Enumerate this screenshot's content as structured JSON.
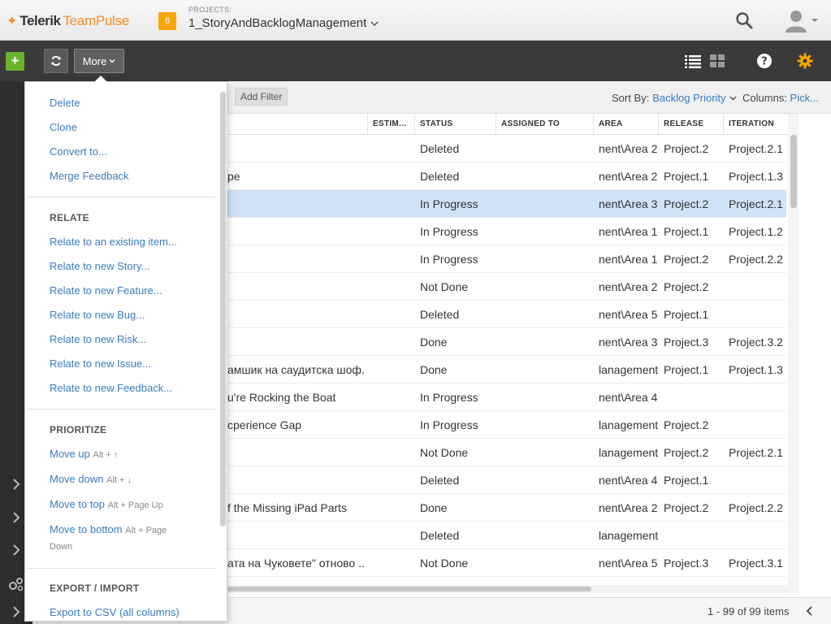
{
  "app": {
    "brand_primary": "Telerik",
    "brand_secondary": "TeamPulse",
    "accent_color": "#f68b1f"
  },
  "project": {
    "badge": "8",
    "caption": "PROJECTS:",
    "name": "1_StoryAndBacklogManagement"
  },
  "toolbar": {
    "more_label": "More",
    "add_icon": "plus-icon",
    "refresh_icon": "refresh-icon"
  },
  "filter": {
    "add_filter_label": "Add Filter",
    "sort_by_label": "Sort By:",
    "sort_by_value": "Backlog Priority",
    "columns_label": "Columns:",
    "columns_value": "Pick..."
  },
  "grid": {
    "headers": [
      "ESTIM...",
      "STATUS",
      "ASSIGNED TO",
      "AREA",
      "RELEASE",
      "ITERATION"
    ],
    "rows": [
      {
        "name": "",
        "status": "Deleted",
        "assigned": "",
        "area": "nent\\Area 2",
        "release": "Project.2",
        "iteration": "Project.2.1"
      },
      {
        "name": "pe",
        "status": "Deleted",
        "assigned": "",
        "area": "nent\\Area 2",
        "release": "Project.1",
        "iteration": "Project.1.3"
      },
      {
        "name": "",
        "status": "In Progress",
        "assigned": "",
        "area": "nent\\Area 3",
        "release": "Project.2",
        "iteration": "Project.2.1"
      },
      {
        "name": "",
        "status": "In Progress",
        "assigned": "",
        "area": "nent\\Area 1",
        "release": "Project.1",
        "iteration": "Project.1.2"
      },
      {
        "name": "",
        "status": "In Progress",
        "assigned": "",
        "area": "nent\\Area 1",
        "release": "Project.2",
        "iteration": "Project.2.2"
      },
      {
        "name": "",
        "status": "Not Done",
        "assigned": "",
        "area": "nent\\Area 2",
        "release": "Project.2",
        "iteration": ""
      },
      {
        "name": "",
        "status": "Deleted",
        "assigned": "",
        "area": "nent\\Area 5",
        "release": "Project.1",
        "iteration": ""
      },
      {
        "name": "",
        "status": "Done",
        "assigned": "",
        "area": "nent\\Area 3",
        "release": "Project.3",
        "iteration": "Project.3.2"
      },
      {
        "name": "амшик на саудитска шоф...",
        "status": "Done",
        "assigned": "",
        "area": "lanagement",
        "release": "Project.1",
        "iteration": "Project.1.3"
      },
      {
        "name": "u're Rocking the Boat",
        "status": "In Progress",
        "assigned": "",
        "area": "nent\\Area 4",
        "release": "",
        "iteration": ""
      },
      {
        "name": "cperience Gap",
        "status": "In Progress",
        "assigned": "",
        "area": "lanagement",
        "release": "Project.2",
        "iteration": ""
      },
      {
        "name": "",
        "status": "Not Done",
        "assigned": "",
        "area": "lanagement",
        "release": "Project.2",
        "iteration": "Project.2.1"
      },
      {
        "name": "",
        "status": "Deleted",
        "assigned": "",
        "area": "nent\\Area 4",
        "release": "Project.1",
        "iteration": ""
      },
      {
        "name": "f the Missing iPad Parts",
        "status": "Done",
        "assigned": "",
        "area": "nent\\Area 2",
        "release": "Project.2",
        "iteration": "Project.2.2"
      },
      {
        "name": "",
        "status": "Deleted",
        "assigned": "",
        "area": "lanagement",
        "release": "",
        "iteration": ""
      },
      {
        "name": "ата на Чуковете\" отново ...",
        "status": "Not Done",
        "assigned": "",
        "area": "nent\\Area 5",
        "release": "Project.3",
        "iteration": "Project.3.1"
      }
    ],
    "selected_row_index": 2
  },
  "pager": {
    "text": "1 - 99 of 99 items"
  },
  "menu": {
    "group1": [
      "Delete",
      "Clone",
      "Convert to...",
      "Merge Feedback"
    ],
    "relate_heading": "RELATE",
    "relate": [
      "Relate to an existing item...",
      "Relate to new Story...",
      "Relate to new Feature...",
      "Relate to new Bug...",
      "Relate to new Risk...",
      "Relate to new Issue...",
      "Relate to new Feedback..."
    ],
    "prioritize_heading": "PRIORITIZE",
    "prioritize": [
      {
        "label": "Move up",
        "shortcut": "Alt + ↑"
      },
      {
        "label": "Move down",
        "shortcut": "Alt + ↓"
      },
      {
        "label": "Move to top",
        "shortcut": "Alt + Page Up"
      },
      {
        "label": "Move to bottom",
        "shortcut": "Alt + Page",
        "shortcut2": "Down"
      }
    ],
    "export_heading": "EXPORT / IMPORT",
    "export_first": "Export to CSV (all columns)"
  }
}
